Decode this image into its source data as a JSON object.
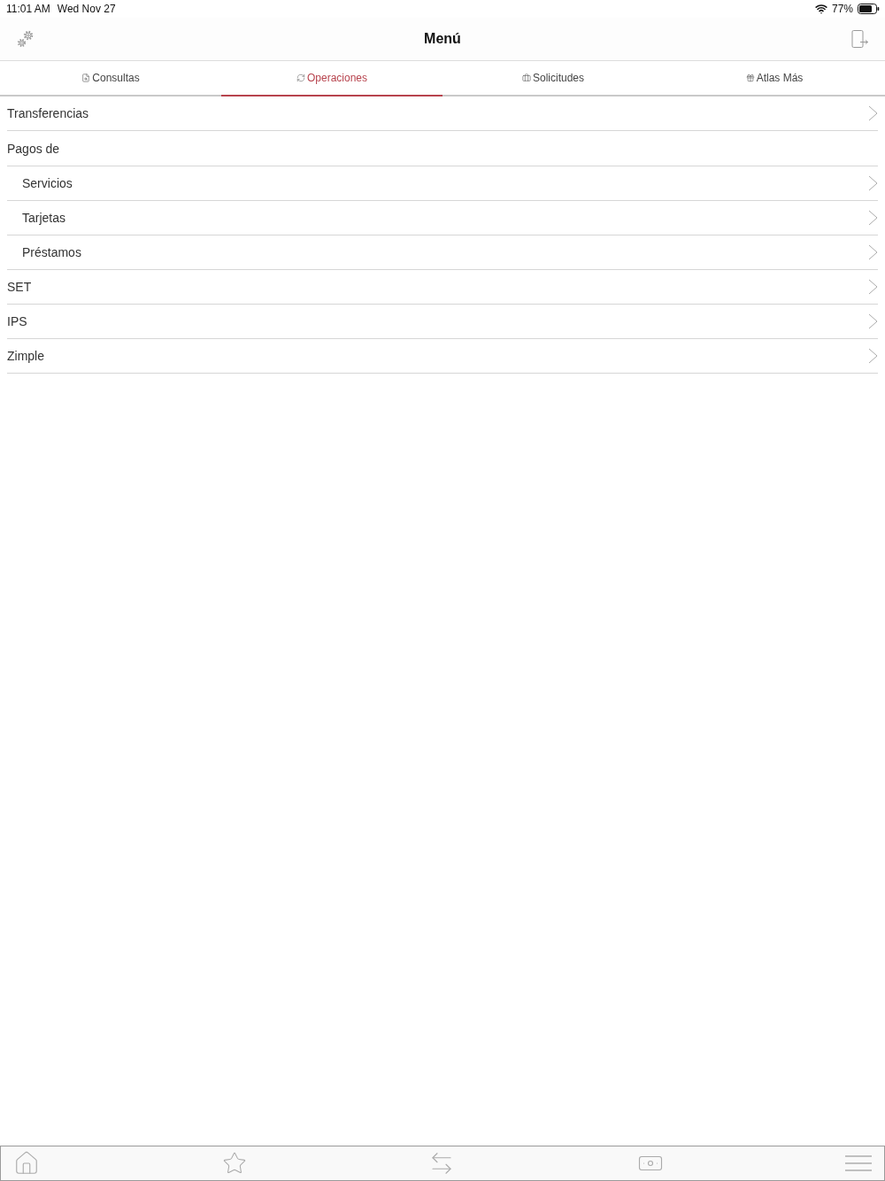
{
  "status_bar": {
    "time": "11:01 AM",
    "date": "Wed Nov 27",
    "battery": "77%"
  },
  "nav_bar": {
    "title": "Menú"
  },
  "tabs": [
    {
      "label": "Consultas",
      "selected": false
    },
    {
      "label": "Operaciones",
      "selected": true
    },
    {
      "label": "Solicitudes",
      "selected": false
    },
    {
      "label": "Atlas Más",
      "selected": false
    }
  ],
  "menu": [
    {
      "label": "Transferencias"
    },
    {
      "label": "Pagos de",
      "children": [
        {
          "label": "Servicios"
        },
        {
          "label": "Tarjetas"
        },
        {
          "label": "Préstamos"
        }
      ]
    },
    {
      "label": "SET"
    },
    {
      "label": "IPS"
    },
    {
      "label": "Zimple"
    }
  ]
}
